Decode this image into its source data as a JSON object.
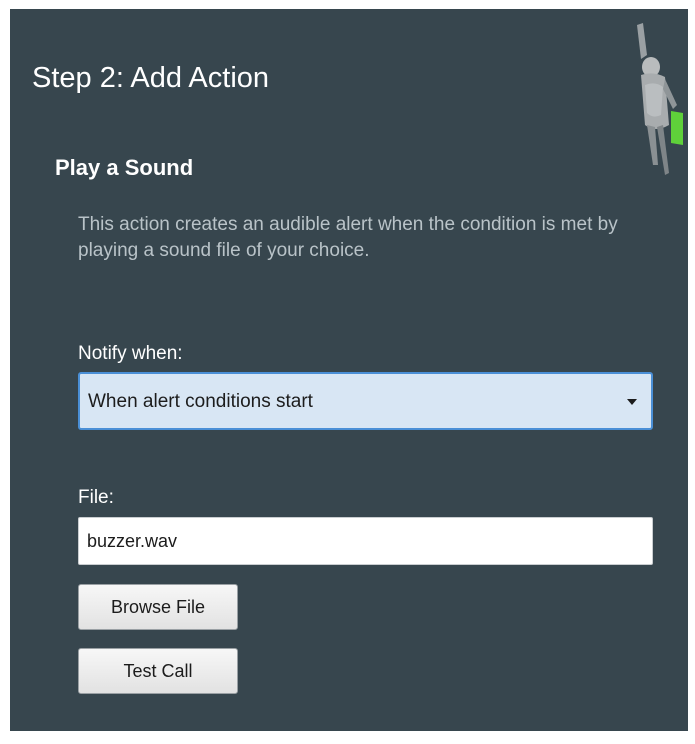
{
  "header": {
    "title": "Step 2:  Add Action",
    "figure_icon": "figure-illustration-icon"
  },
  "section": {
    "title": "Play a Sound",
    "description": "This action creates an audible alert when the condition is met by playing a sound file of your choice."
  },
  "notify": {
    "label": "Notify when:",
    "selected": "When alert conditions start",
    "icon": "chevron-down-icon"
  },
  "file": {
    "label": "File:",
    "value": "buzzer.wav"
  },
  "buttons": {
    "browse_label": "Browse File",
    "test_label": "Test Call"
  },
  "colors": {
    "panel_bg": "#37464e",
    "select_bg": "#d8e6f4",
    "select_border": "#4a8fd6",
    "figure_accent": "#5fd13a"
  }
}
